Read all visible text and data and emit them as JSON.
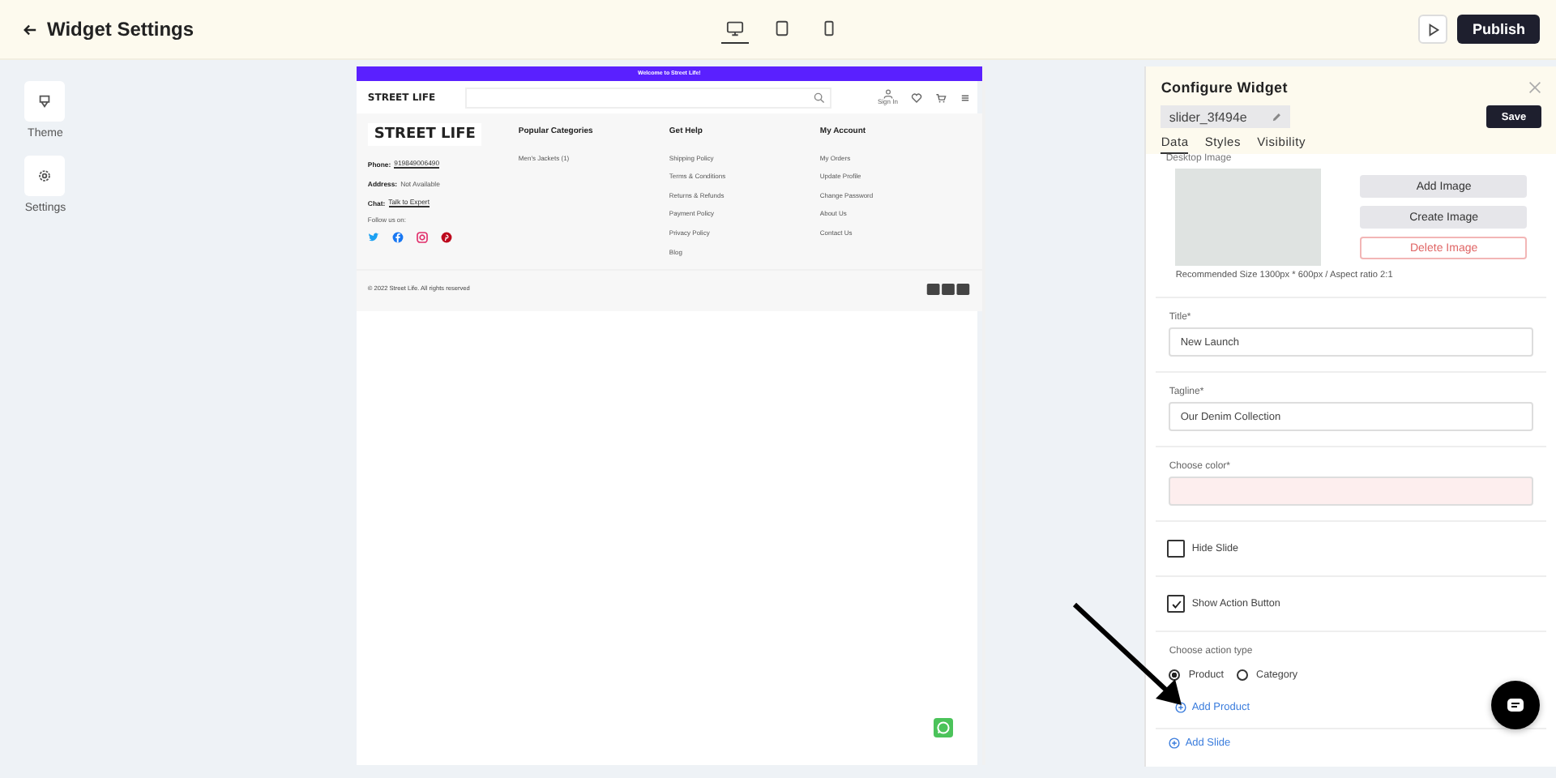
{
  "topbar": {
    "title": "Widget Settings",
    "devices": [
      {
        "kind": "desktop",
        "selected": true
      },
      {
        "kind": "tablet",
        "selected": false
      },
      {
        "kind": "mobile",
        "selected": false
      }
    ],
    "publish": "Publish"
  },
  "sidebar": {
    "items": [
      {
        "kind": "theme",
        "label": "Theme"
      },
      {
        "kind": "settings",
        "label": "Settings"
      }
    ]
  },
  "preview": {
    "announcement": "Welcome to Street Life!",
    "header_logo": "STREET LIFE",
    "footer_logo": "STREET LIFE",
    "sign_in": "Sign In",
    "contact": [
      {
        "label": "Phone:",
        "value": "919849006490",
        "link": true
      },
      {
        "label": "Address:",
        "value": "Not Available",
        "link": false
      },
      {
        "label": "Chat:",
        "value": "Talk to Expert",
        "link": true
      }
    ],
    "follow_label": "Follow us on:",
    "socials": [
      {
        "kind": "twitter",
        "color": "#1da1f2"
      },
      {
        "kind": "facebook",
        "color": "#1877f2"
      },
      {
        "kind": "instagram",
        "color": "#e1306c"
      },
      {
        "kind": "pinterest",
        "color": "#bd081c"
      }
    ],
    "columns": [
      {
        "heading": "Popular Categories",
        "links": [
          "Men's Jackets (1)"
        ]
      },
      {
        "heading": "Get Help",
        "links": [
          "Shipping Policy",
          "Terms & Conditions",
          "Returns & Refunds",
          "Payment Policy",
          "Privacy Policy",
          "Blog"
        ]
      },
      {
        "heading": "My Account",
        "links": [
          "My Orders",
          "Update Profile",
          "Change Password",
          "About Us",
          "Contact Us"
        ]
      }
    ],
    "copyright": "© 2022 Street Life. All rights reserved"
  },
  "panel": {
    "title": "Configure Widget",
    "widget_id": "slider_3f494e",
    "save": "Save",
    "tabs": [
      {
        "label": "Data",
        "selected": true
      },
      {
        "label": "Styles",
        "selected": false
      },
      {
        "label": "Visibility",
        "selected": false
      }
    ],
    "image_label": "Desktop Image",
    "image_buttons": [
      {
        "kind": "plain",
        "label": "Add Image"
      },
      {
        "kind": "plain",
        "label": "Create Image"
      },
      {
        "kind": "danger",
        "label": "Delete Image"
      }
    ],
    "recommendation": "Recommended Size 1300px * 600px / Aspect ratio 2:1",
    "fields": [
      {
        "kind": "text",
        "label": "Title*",
        "value": "New Launch"
      },
      {
        "kind": "text",
        "label": "Tagline*",
        "value": "Our Denim Collection"
      },
      {
        "kind": "color",
        "label": "Choose color*"
      }
    ],
    "checkboxes": [
      {
        "label": "Hide Slide",
        "checked": false
      },
      {
        "label": "Show Action Button",
        "checked": true
      }
    ],
    "action_label": "Choose action type",
    "radios": [
      {
        "label": "Product",
        "selected": true
      },
      {
        "label": "Category",
        "selected": false
      }
    ],
    "add_product": "Add Product",
    "add_slide": "Add Slide"
  }
}
